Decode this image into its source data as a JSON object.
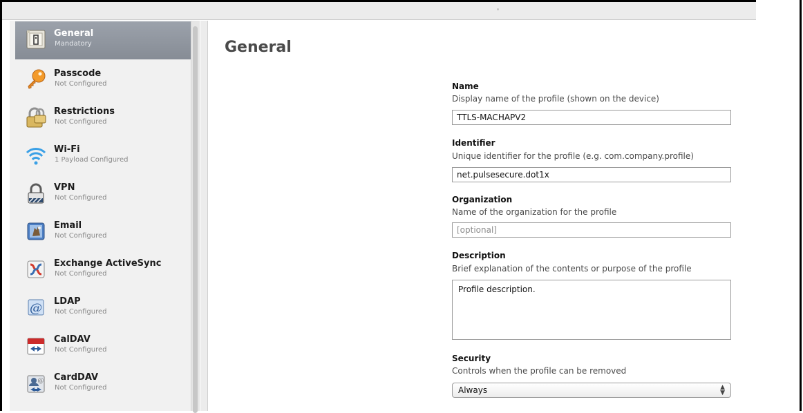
{
  "sidebar": {
    "items": [
      {
        "name": "General",
        "status": "Mandatory",
        "icon": "general-icon"
      },
      {
        "name": "Passcode",
        "status": "Not Configured",
        "icon": "key-icon"
      },
      {
        "name": "Restrictions",
        "status": "Not Configured",
        "icon": "padlock-icon"
      },
      {
        "name": "Wi-Fi",
        "status": "1 Payload Configured",
        "icon": "wifi-icon"
      },
      {
        "name": "VPN",
        "status": "Not Configured",
        "icon": "vpn-lock-icon"
      },
      {
        "name": "Email",
        "status": "Not Configured",
        "icon": "email-stamp-icon"
      },
      {
        "name": "Exchange ActiveSync",
        "status": "Not Configured",
        "icon": "exchange-icon"
      },
      {
        "name": "LDAP",
        "status": "Not Configured",
        "icon": "ldap-at-icon"
      },
      {
        "name": "CalDAV",
        "status": "Not Configured",
        "icon": "calendar-icon"
      },
      {
        "name": "CardDAV",
        "status": "Not Configured",
        "icon": "contacts-icon"
      }
    ]
  },
  "main": {
    "title": "General",
    "name": {
      "label": "Name",
      "help": "Display name of the profile (shown on the device)",
      "value": "TTLS-MACHAPV2"
    },
    "identifier": {
      "label": "Identifier",
      "help": "Unique identifier for the profile (e.g. com.company.profile)",
      "value": "net.pulsesecure.dot1x"
    },
    "organization": {
      "label": "Organization",
      "help": "Name of the organization for the profile",
      "placeholder": "[optional]"
    },
    "description": {
      "label": "Description",
      "help": "Brief explanation of the contents or purpose of the profile",
      "value": "Profile description."
    },
    "security": {
      "label": "Security",
      "help": "Controls when the profile can be removed",
      "value": "Always"
    }
  },
  "colors": {
    "selection": "#8d939c",
    "sidebar_bg": "#f1f1f1",
    "heading": "#4a4a4a"
  }
}
